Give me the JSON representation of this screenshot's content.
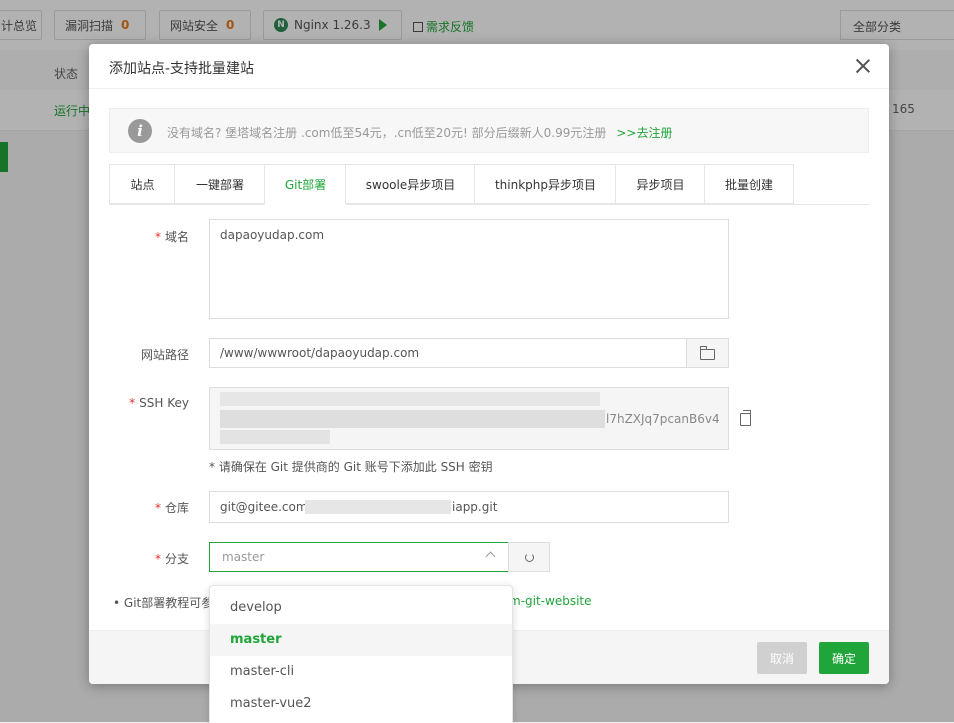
{
  "background": {
    "topbar": [
      {
        "label": "计总览",
        "count": ""
      },
      {
        "label": "漏洞扫描",
        "count": "0"
      },
      {
        "label": "网站安全",
        "count": "0"
      },
      {
        "label": "Nginx 1.26.3",
        "count": ""
      }
    ],
    "nginx_badge": "N",
    "feedback": "需求反馈",
    "category": "全部分类",
    "status_header": "状态",
    "running": "运行中",
    "row_tail": "165"
  },
  "modal": {
    "title": "添加站点-支持批量建站",
    "notice": {
      "text": "没有域名? 堡塔域名注册 .com低至54元，.cn低至20元! 部分后缀新人0.99元注册",
      "link": ">>去注册"
    },
    "tabs": [
      {
        "label": "站点"
      },
      {
        "label": "一键部署"
      },
      {
        "label": "Git部署"
      },
      {
        "label": "swoole异步项目"
      },
      {
        "label": "thinkphp异步项目"
      },
      {
        "label": "异步项目"
      },
      {
        "label": "批量创建"
      }
    ],
    "active_tab": "Git部署",
    "form": {
      "domain_label": "域名",
      "domain_value": "dapaoyudap.com",
      "path_label": "网站路径",
      "path_value": "/www/wwwroot/dapaoyudap.com",
      "ssh_label": "SSH Key",
      "ssh_visible_tail": "l7hZXJq7pcanB6v4",
      "ssh_hint": "* 请确保在 Git 提供商的 Git 账号下添加此 SSH 密钥",
      "repo_label": "仓库",
      "repo_prefix": "git@gitee.com",
      "repo_suffix": "iapp.git",
      "branch_label": "分支",
      "branch_value": "master",
      "tutorial_text": "Git部署教程可参",
      "tutorial_link": "m-git-website"
    },
    "footer": {
      "cancel": "取消",
      "confirm": "确定"
    }
  },
  "branch_dropdown": {
    "options": [
      "develop",
      "master",
      "master-cli",
      "master-vue2"
    ],
    "selected": "master"
  },
  "colors": {
    "accent": "#20a53a",
    "required": "#e8302d",
    "count": "#e8791a"
  }
}
